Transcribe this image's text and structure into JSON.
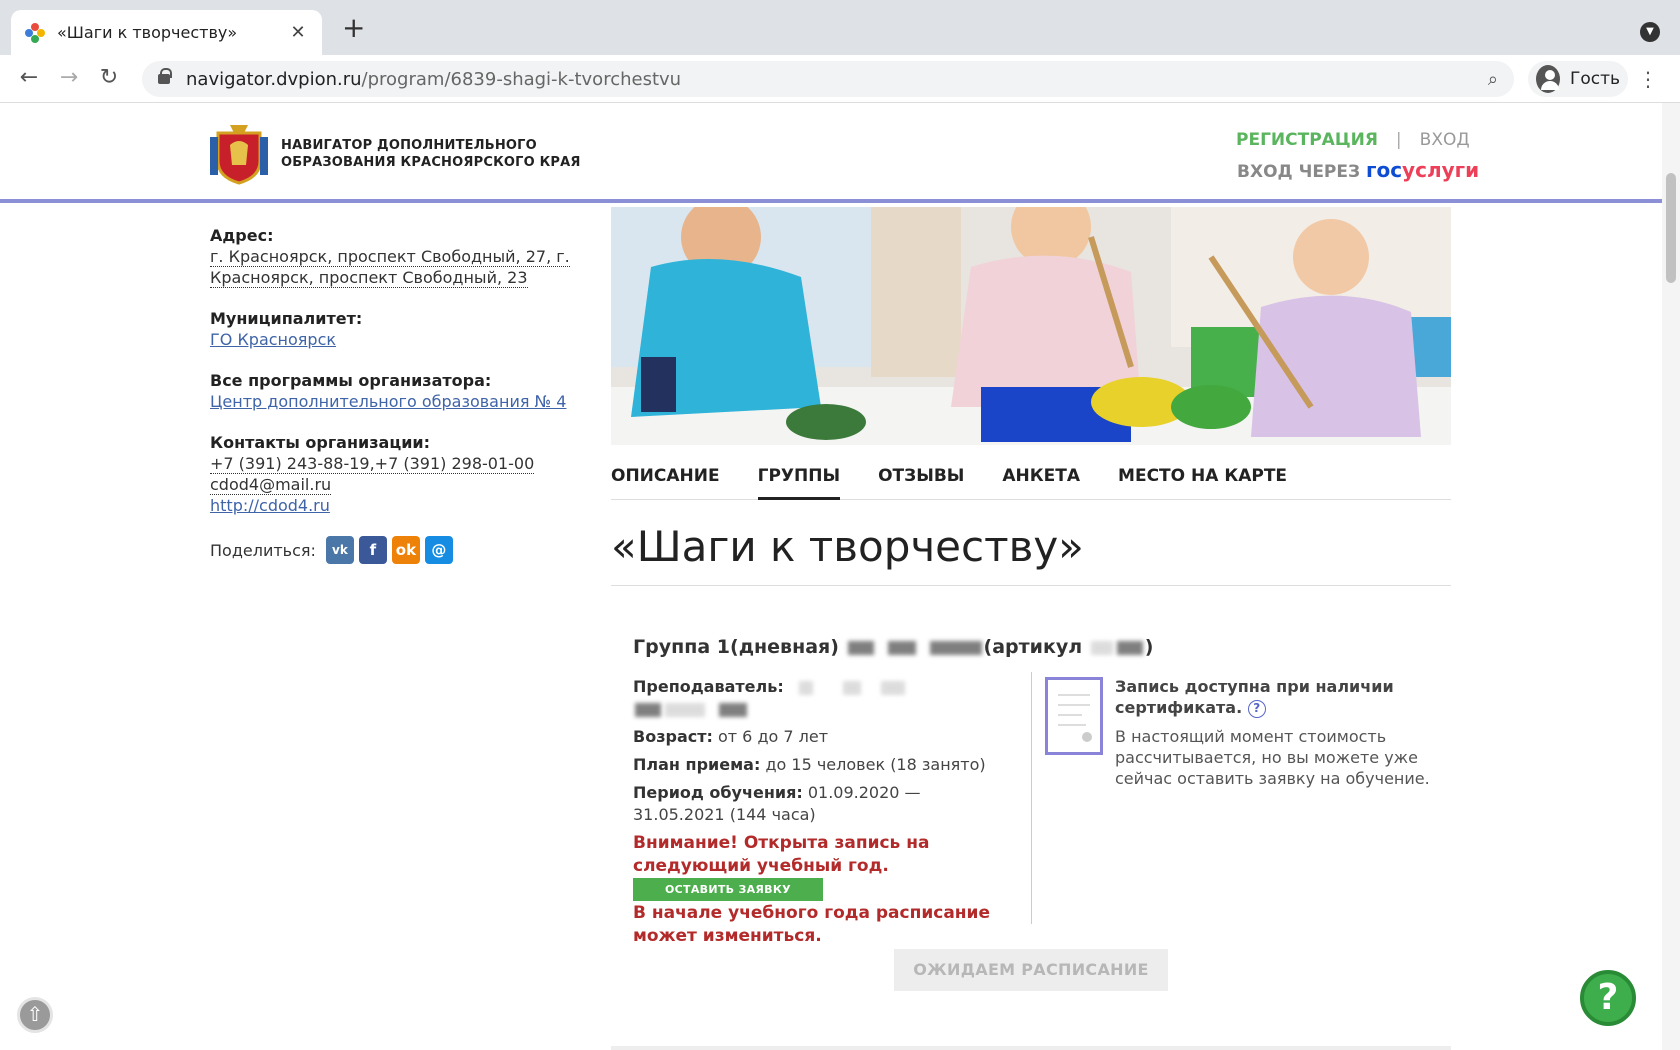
{
  "browser": {
    "tab_title": "«Шаги к творчеству»",
    "tab_close": "✕",
    "new_tab": "+",
    "url_host": "navigator.dvpion.ru",
    "url_path": "/program/6839-shagi-k-tvorchestvu",
    "profile_label": "Гость"
  },
  "header": {
    "logo_line1": "НАВИГАТОР ДОПОЛНИТЕЛЬНОГО",
    "logo_line2": "ОБРАЗОВАНИЯ КРАСНОЯРСКОГО КРАЯ",
    "register": "РЕГИСТРАЦИЯ",
    "separator": "|",
    "login": "ВХОД",
    "login_via": "ВХОД ЧЕРЕЗ",
    "gos_part1": "гос",
    "gos_part2": "услуги",
    "colors": {
      "accent_green": "#5ab55e",
      "border_purple": "#8b8fd6"
    }
  },
  "sidebar": {
    "address_label": "Адрес:",
    "address_line1": "г. Красноярск, проспект Свободный, 27, г.",
    "address_line2": "Красноярск, проспект Свободный, 23",
    "municipality_label": "Муниципалитет:",
    "municipality_value": "ГО Красноярск",
    "organizer_label": "Все программы организатора:",
    "organizer_value": "Центр дополнительного образования № 4",
    "contacts_label": "Контакты организации:",
    "phones": "+7 (391) 243-88-19,+7 (391) 298-01-00",
    "email": "cdod4@mail.ru",
    "website": "http://cdod4.ru",
    "share_label": "Поделиться:",
    "share_icons": [
      "vk-icon",
      "facebook-icon",
      "odnoklassniki-icon",
      "mail-ru-icon"
    ]
  },
  "main": {
    "tabs": [
      {
        "label": "ОПИСАНИЕ",
        "active": false
      },
      {
        "label": "ГРУППЫ",
        "active": true
      },
      {
        "label": "ОТЗЫВЫ",
        "active": false
      },
      {
        "label": "АНКЕТА",
        "active": false
      },
      {
        "label": "МЕСТО НА КАРТЕ",
        "active": false
      }
    ],
    "title": "«Шаги к творчеству»",
    "group": {
      "name": "Группа 1(дневная)",
      "article_prefix": "(артикул",
      "article_suffix": ")",
      "teacher_label": "Преподаватель:",
      "age_label": "Возраст:",
      "age_value": "от 6 до 7 лет",
      "plan_label": "План приема:",
      "plan_value": "до 15 человек (18 занято)",
      "period_label": "Период обучения:",
      "period_value": "01.09.2020 — 31.05.2021 (144 часа)",
      "warning1": "Внимание! Открыта запись на следующий учебный год.",
      "apply_button": "ОСТАВИТЬ ЗАЯВКУ",
      "warning2": "В начале учебного года расписание может измениться.",
      "cert_title": "Запись доступна при наличии сертификата.",
      "cert_help": "?",
      "cert_desc": "В настоящий момент стоимость рассчитывается, но вы можете уже сейчас оставить заявку на обучение."
    },
    "wait_button": "ОЖИДАЕМ РАСПИСАНИЕ"
  },
  "floating": {
    "scroll_up": "⇧",
    "help": "?"
  }
}
